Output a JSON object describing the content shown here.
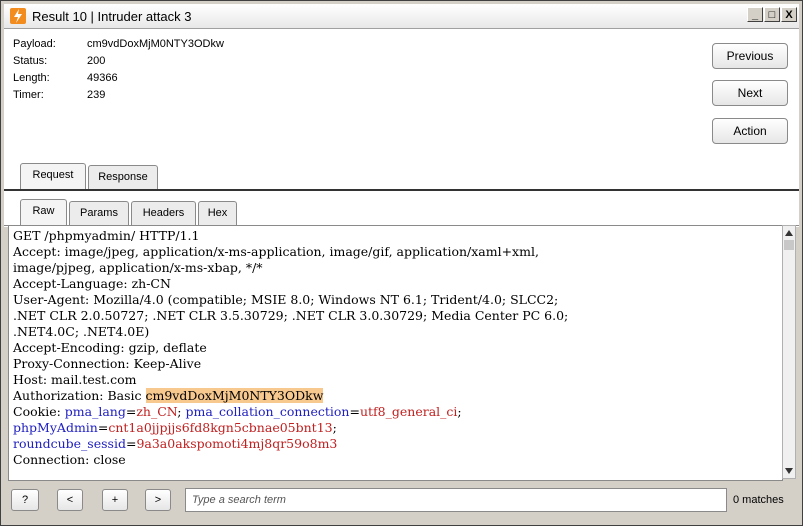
{
  "window": {
    "title": "Result 10 | Intruder attack 3",
    "controls": {
      "minimize": "_",
      "maximize": "□",
      "close": "X"
    }
  },
  "info": {
    "payload_label": "Payload:",
    "payload_value": "cm9vdDoxMjM0NTY3ODkw",
    "status_label": "Status:",
    "status_value": "200",
    "length_label": "Length:",
    "length_value": "49366",
    "timer_label": "Timer:",
    "timer_value": "239"
  },
  "actions": {
    "previous": "Previous",
    "next": "Next",
    "action": "Action"
  },
  "main_tabs": [
    {
      "label": "Request"
    },
    {
      "label": "Response"
    }
  ],
  "sub_tabs": [
    {
      "label": "Raw"
    },
    {
      "label": "Params"
    },
    {
      "label": "Headers"
    },
    {
      "label": "Hex"
    }
  ],
  "request": {
    "line1": "GET /phpmyadmin/ HTTP/1.1",
    "line2": "Accept: image/jpeg, application/x-ms-application, image/gif, application/xaml+xml,",
    "line3": "image/pjpeg, application/x-ms-xbap, */*",
    "line4": "Accept-Language: zh-CN",
    "line5": "User-Agent: Mozilla/4.0 (compatible; MSIE 8.0; Windows NT 6.1; Trident/4.0; SLCC2;",
    "line6": ".NET CLR 2.0.50727; .NET CLR 3.5.30729; .NET CLR 3.0.30729; Media Center PC 6.0;",
    "line7": ".NET4.0C; .NET4.0E)",
    "line8": "Accept-Encoding: gzip, deflate",
    "line9": "Proxy-Connection: Keep-Alive",
    "line10": "Host: mail.test.com",
    "auth_prefix": "Authorization: Basic ",
    "auth_value": "cm9vdDoxMjM0NTY3ODkw",
    "cookie_prefix": "Cookie: ",
    "c1_name": "pma_lang",
    "c1_eq": "=",
    "c1_value": "zh_CN",
    "c1_sep": "; ",
    "c2_name": "pma_collation_connection",
    "c2_eq": "=",
    "c2_value": "utf8_general_ci",
    "c2_sep": ";",
    "c3_name": "phpMyAdmin",
    "c3_eq": "=",
    "c3_value": "cnt1a0jjpjjs6fd8kgn5cbnae05bnt13",
    "c3_sep": ";",
    "c4_name": "roundcube_sessid",
    "c4_eq": "=",
    "c4_value": "9a3a0akspomoti4mj8qr59o8m3",
    "line_last": "Connection: close"
  },
  "search": {
    "help_label": "?",
    "prev_label": "<",
    "add_label": "+",
    "next_label": ">",
    "placeholder": "Type a search term",
    "matches": "0 matches"
  },
  "colors": {
    "highlight": "#f8c98f",
    "cookie_name": "#2020c0",
    "cookie_value": "#c02020",
    "app_icon": "#f28c1e"
  }
}
